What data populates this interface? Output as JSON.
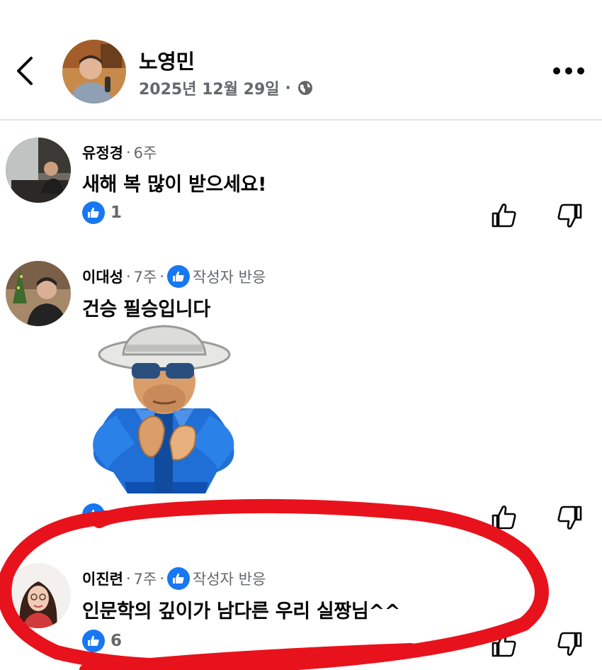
{
  "post": {
    "author": "노영민",
    "date": "2025년 12월 29일",
    "separator": "·",
    "icons": {
      "back": "chevron-left-icon",
      "privacy": "globe-icon",
      "more": "more-horizontal-icon"
    }
  },
  "comments": [
    {
      "author": "유정경",
      "sep": "·",
      "time": "6주",
      "text": "새해 복 많이 받으세요!",
      "likes": "1",
      "author_reacted": false
    },
    {
      "author": "이대성",
      "sep": "·",
      "time": "7주",
      "sep2": "·",
      "author_reaction": "작성자 반응",
      "text": "건승 필승입니다",
      "likes": "",
      "sticker": "clapping-man-in-hat-sticker",
      "author_reacted": true
    },
    {
      "author": "이진련",
      "sep": "·",
      "time": "7주",
      "sep2": "·",
      "author_reaction": "작성자 반응",
      "text": "인문학의 깊이가 남다른 우리 실짱님^^",
      "likes": "6",
      "author_reacted": true
    }
  ],
  "colors": {
    "accent": "#1877f2",
    "secondary_text": "#65676b",
    "highlight": "#e8121c"
  }
}
